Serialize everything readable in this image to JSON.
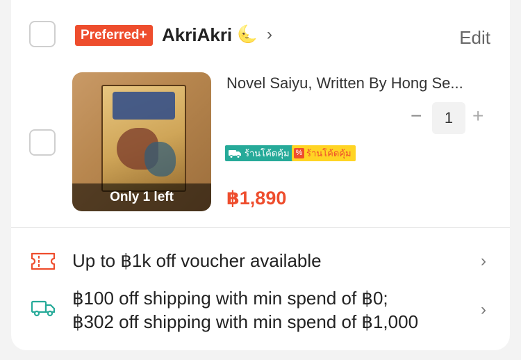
{
  "shop": {
    "badge": "Preferred+",
    "name": "AkriAkri",
    "name_emoji": "🌜",
    "edit_label": "Edit"
  },
  "item": {
    "title": "Novel Saiyu, Written By Hong Se...",
    "stock_label": "Only 1 left",
    "quantity": "1",
    "qty_minus": "−",
    "qty_plus": "+",
    "tag_free_shipping": "ร้านโค้ดคุ้ม",
    "tag_discount": "ร้านโค้ดคุ้ม",
    "price": "฿1,890"
  },
  "offers": {
    "voucher_text": "Up to ฿1k off voucher available",
    "shipping_line1": "฿100 off shipping with min spend of ฿0;",
    "shipping_line2": "฿302 off shipping with min spend of ฿1,000"
  },
  "icons": {
    "voucher": "ticket-icon",
    "shipping": "truck-icon",
    "chevron": "chevron-right-icon"
  },
  "colors": {
    "accent": "#ee4d2d",
    "teal": "#26aa99",
    "yellow": "#ffd424"
  }
}
